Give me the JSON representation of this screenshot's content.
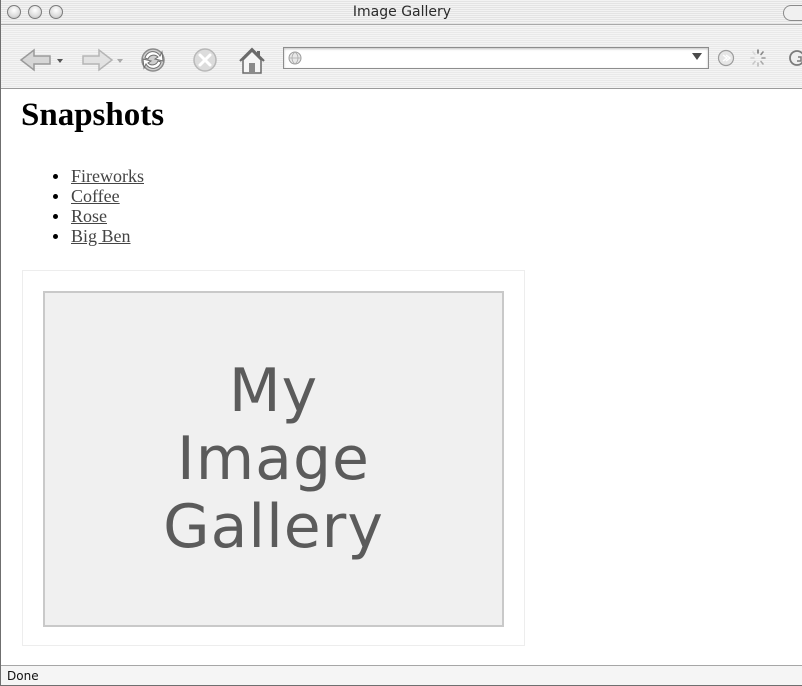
{
  "window": {
    "title": "Image Gallery"
  },
  "toolbar": {
    "url_value": "",
    "icons": [
      "back-icon",
      "forward-icon",
      "reload-icon",
      "stop-icon",
      "home-icon",
      "globe-icon",
      "dropdown-icon",
      "go-icon",
      "spinner-icon",
      "search-icon"
    ]
  },
  "page": {
    "heading": "Snapshots",
    "links": [
      {
        "label": "Fireworks"
      },
      {
        "label": "Coffee"
      },
      {
        "label": "Rose"
      },
      {
        "label": "Big Ben"
      }
    ],
    "placeholder_text": "My\nImage\nGallery"
  },
  "statusbar": {
    "text": "Done"
  },
  "colors": {
    "link": "#444444",
    "placeholder_bg": "#f0f0f0",
    "placeholder_text": "#5b5b5b"
  }
}
